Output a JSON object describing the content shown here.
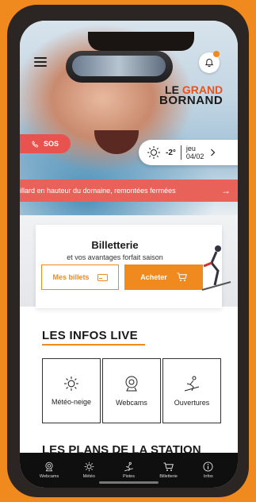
{
  "header": {
    "logo_line1_a": "LE",
    "logo_line1_b": "GRAND",
    "logo_line2": "BORNAND"
  },
  "sos": {
    "label": "SOS"
  },
  "weather": {
    "temperature": "-2°",
    "day": "jeu",
    "date": "04/02"
  },
  "banner": {
    "text": "illard en hauteur du domaine, remontées fermées"
  },
  "billetterie": {
    "title": "Billetterie",
    "subtitle": "et vos avantages forfait saison",
    "my_tickets_label": "Mes billets",
    "buy_label": "Acheter"
  },
  "infos_live": {
    "title": "LES INFOS LIVE",
    "tiles": [
      {
        "label": "Météo-neige",
        "icon": "sun-icon"
      },
      {
        "label": "Webcams",
        "icon": "webcam-icon"
      },
      {
        "label": "Ouvertures",
        "icon": "skier-icon"
      }
    ]
  },
  "plans": {
    "title": "LES PLANS DE LA STATION"
  },
  "tabbar": {
    "items": [
      {
        "label": "Webcams",
        "icon": "webcam-icon"
      },
      {
        "label": "Météo",
        "icon": "sun-icon"
      },
      {
        "label": "Pistes",
        "icon": "skier-icon"
      },
      {
        "label": "Billetterie",
        "icon": "cart-icon"
      },
      {
        "label": "Infos",
        "icon": "info-icon"
      }
    ]
  },
  "colors": {
    "accent": "#f08a1f",
    "sos": "#e8534f",
    "banner": "#e8625a"
  }
}
